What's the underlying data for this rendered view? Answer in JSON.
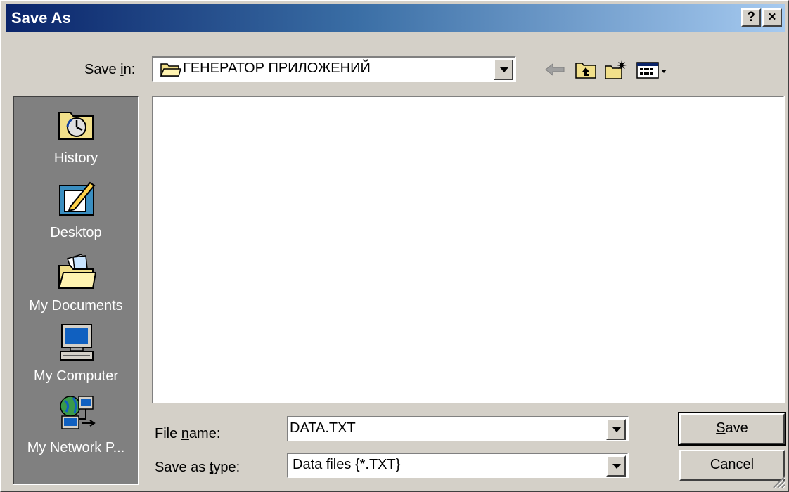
{
  "window": {
    "title": "Save As",
    "help_label": "?",
    "close_label": "×"
  },
  "save_in": {
    "label_pre": "Save ",
    "label_key": "i",
    "label_post": "n:",
    "value": "ГЕНЕРАТОР ПРИЛОЖЕНИЙ"
  },
  "toolbar": {
    "icons": [
      "back-arrow-icon",
      "up-one-level-icon",
      "new-folder-icon",
      "view-menu-icon"
    ]
  },
  "places": [
    {
      "label": "History",
      "icon": "history-icon"
    },
    {
      "label": "Desktop",
      "icon": "desktop-icon"
    },
    {
      "label": "My Documents",
      "icon": "my-documents-icon"
    },
    {
      "label": "My Computer",
      "icon": "my-computer-icon"
    },
    {
      "label": "My Network P...",
      "icon": "my-network-places-icon"
    }
  ],
  "file_name": {
    "label_pre": "File ",
    "label_key": "n",
    "label_post": "ame:",
    "value": "DATA.TXT"
  },
  "save_as_type": {
    "label_pre": "Save as ",
    "label_key": "t",
    "label_post": "ype:",
    "value": "Data files {*.TXT}"
  },
  "buttons": {
    "save_key": "S",
    "save_rest": "ave",
    "cancel": "Cancel"
  },
  "colors": {
    "titlebar_start": "#0a246a",
    "titlebar_end": "#a6caf0",
    "face": "#d4d0c8",
    "places_bg": "#808080"
  }
}
